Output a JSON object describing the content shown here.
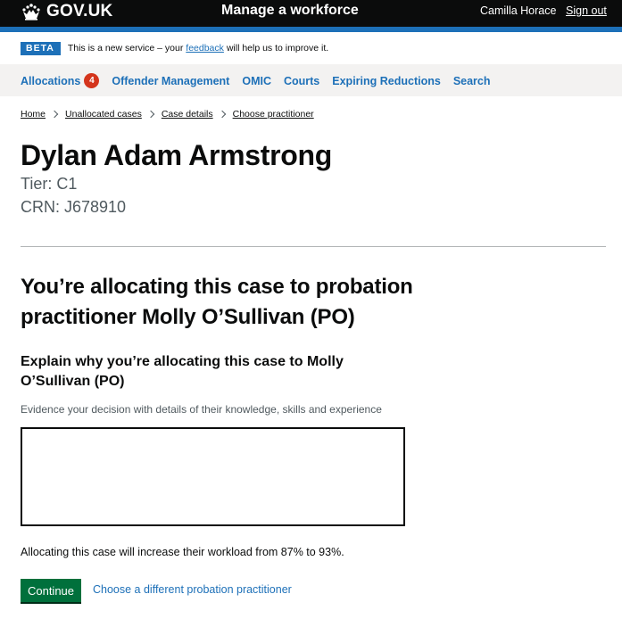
{
  "header": {
    "logo_text": "GOV.UK",
    "service_name": "Manage a workforce",
    "user_name": "Camilla Horace",
    "sign_out": "Sign out"
  },
  "phase_banner": {
    "tag": "BETA",
    "text_before": "This is a new service – your ",
    "link": "feedback",
    "text_after": " will help us to improve it."
  },
  "nav": {
    "items": [
      {
        "label": "Allocations",
        "badge": "4"
      },
      {
        "label": "Offender Management"
      },
      {
        "label": "OMIC"
      },
      {
        "label": "Courts"
      },
      {
        "label": "Expiring Reductions"
      },
      {
        "label": "Search"
      }
    ]
  },
  "breadcrumbs": [
    "Home",
    "Unallocated cases",
    "Case details",
    "Choose practitioner"
  ],
  "person": {
    "name": "Dylan Adam Armstrong",
    "tier": "Tier: C1",
    "crn": "CRN: J678910"
  },
  "main": {
    "heading": "You’re allocating this case to probation practitioner Molly O’Sullivan (PO)",
    "label": "Explain why you’re allocating this case to Molly O’Sullivan (PO)",
    "hint": "Evidence your decision with details of their knowledge, skills and experience",
    "textarea_value": "",
    "workload": "Allocating this case will increase their workload from 87% to 93%.",
    "continue_button": "Continue",
    "alt_link": "Choose a different probation practitioner"
  },
  "colors": {
    "header_bg": "#0b0c0c",
    "header_stripe": "#1d70b8",
    "link": "#1d70b8",
    "button": "#00703c",
    "badge": "#d4351c",
    "nav_bg": "#f3f2f1"
  },
  "icons": [
    "crown-icon",
    "chevron-right-icon"
  ]
}
